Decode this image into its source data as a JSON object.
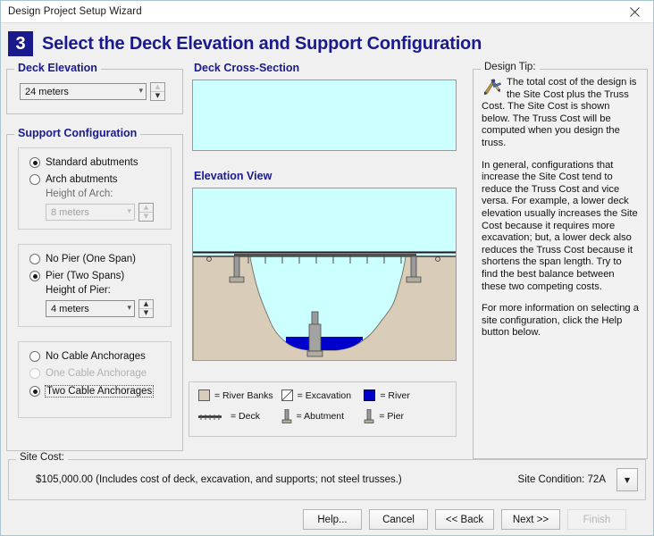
{
  "window": {
    "title": "Design Project Setup Wizard",
    "close_icon": "close-icon"
  },
  "header": {
    "step_number": "3",
    "title": "Select the Deck Elevation and Support Configuration"
  },
  "deck_elevation": {
    "group_label": "Deck Elevation",
    "value": "24 meters",
    "caret": "⌄",
    "spin_up": "▲",
    "spin_down": "▼"
  },
  "support_configuration": {
    "group_label": "Support Configuration",
    "abutments": {
      "options": [
        {
          "label": "Standard abutments",
          "selected": true,
          "disabled": false
        },
        {
          "label": "Arch abutments",
          "selected": false,
          "disabled": false
        }
      ],
      "sub_label": "Height of Arch:",
      "value": "8 meters",
      "disabled": true
    },
    "piers": {
      "options": [
        {
          "label": "No Pier (One Span)",
          "selected": false,
          "disabled": false
        },
        {
          "label": "Pier (Two Spans)",
          "selected": true,
          "disabled": false
        }
      ],
      "sub_label": "Height of Pier:",
      "value": "4 meters",
      "disabled": false
    },
    "anchorages": {
      "options": [
        {
          "label": "No Cable Anchorages",
          "selected": false,
          "disabled": false
        },
        {
          "label": "One Cable Anchorage",
          "selected": false,
          "disabled": true
        },
        {
          "label": "Two Cable Anchorages",
          "selected": true,
          "disabled": false,
          "focused": true
        }
      ]
    }
  },
  "deck_cross_section": {
    "group_label": "Deck Cross-Section"
  },
  "elevation_view": {
    "group_label": "Elevation View"
  },
  "legend": {
    "items": [
      {
        "label": "= River Banks",
        "icon": "river-banks-swatch"
      },
      {
        "label": "= Excavation",
        "icon": "excavation-swatch"
      },
      {
        "label": "= River",
        "icon": "river-swatch"
      },
      {
        "label": "= Deck",
        "icon": "deck-swatch"
      },
      {
        "label": "= Abutment",
        "icon": "abutment-swatch"
      },
      {
        "label": "= Pier",
        "icon": "pier-swatch"
      }
    ]
  },
  "design_tip": {
    "group_label": "Design Tip:",
    "icon": "drafting-compass-icon",
    "paragraphs": [
      "The total cost of the design is the Site Cost plus the Truss Cost. The Site Cost is shown below. The Truss Cost will be computed when you design the truss.",
      "In general, configurations that increase the Site Cost tend to reduce the Truss Cost and vice versa. For example, a lower deck elevation usually increases the Site Cost because it requires more excavation; but, a lower deck also reduces the Truss Cost because it shortens the span length. Try to find the best balance between these two competing costs.",
      "For more information on selecting a site configuration, click the Help button below."
    ]
  },
  "site_cost": {
    "group_label": "Site Cost:",
    "value": "$105,000.00  (Includes cost of deck, excavation, and supports; not steel trusses.)",
    "site_condition": "Site Condition: 72A",
    "dropdown_caret": "▼"
  },
  "buttons": [
    {
      "label": "Help...",
      "disabled": false,
      "name": "help-button"
    },
    {
      "label": "Cancel",
      "disabled": false,
      "name": "cancel-button"
    },
    {
      "label": "<< Back",
      "disabled": false,
      "name": "back-button"
    },
    {
      "label": "Next >>",
      "disabled": false,
      "name": "next-button"
    },
    {
      "label": "Finish",
      "disabled": true,
      "name": "finish-button"
    }
  ],
  "colors": {
    "sky": "#ccffff",
    "ground": "#d9ccb8",
    "river": "#0000cc",
    "header_blue": "#1a1a8c",
    "steel": "#8f8f8f"
  }
}
